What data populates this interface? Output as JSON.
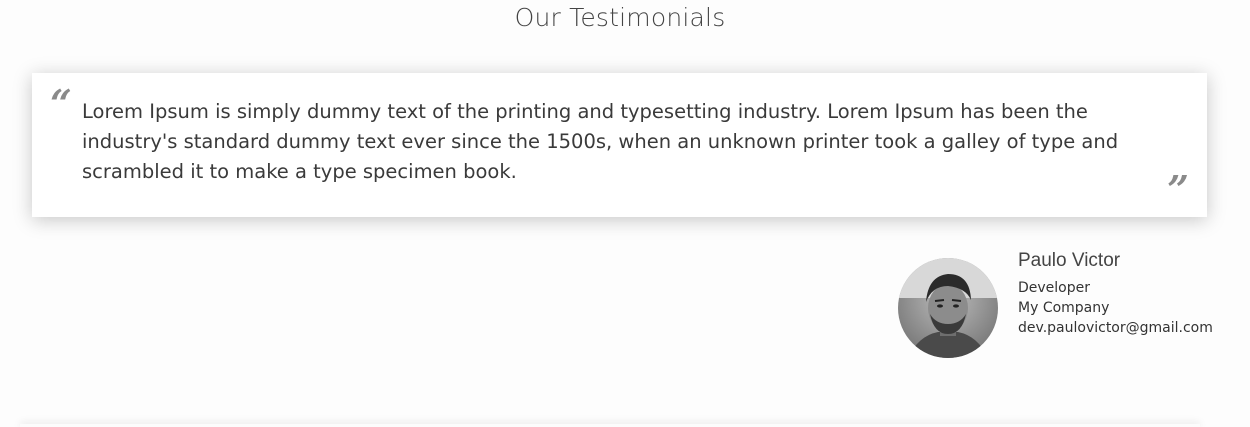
{
  "section": {
    "title": "Our Testimonials"
  },
  "testimonial": {
    "open_quote": "“",
    "close_quote": "”",
    "text": "Lorem Ipsum is simply dummy text of the printing and typesetting industry. Lorem Ipsum has been the industry's standard dummy text ever since the 1500s, when an unknown printer took a galley of type and scrambled it to make a type specimen book."
  },
  "author": {
    "name": "Paulo Victor",
    "role": "Developer",
    "company": "My Company",
    "email": "dev.paulovictor@gmail.com",
    "avatar_icon": "user-photo"
  },
  "colors": {
    "quote_mark": "#8a8a8a",
    "card_background": "#ffffff",
    "page_background": "#fdfdfd"
  }
}
